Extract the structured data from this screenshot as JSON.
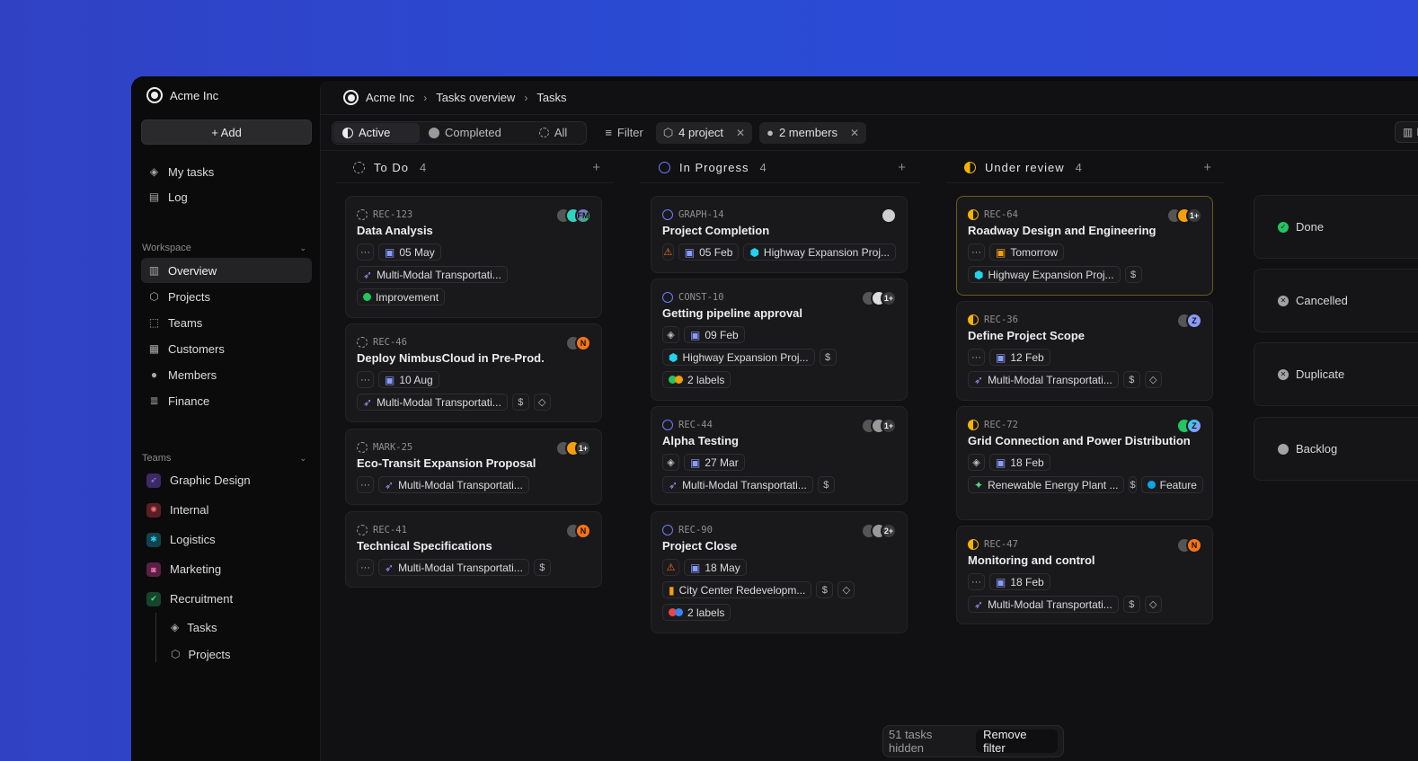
{
  "workspace": {
    "name": "Acme Inc",
    "add_label": "+ Add"
  },
  "nav": {
    "top": [
      {
        "label": "My tasks",
        "icon": "layers-icon"
      },
      {
        "label": "Log",
        "icon": "document-icon"
      }
    ],
    "workspace_heading": "Workspace",
    "workspace_items": [
      {
        "label": "Overview",
        "icon": "bar-chart-icon",
        "active": true
      },
      {
        "label": "Projects",
        "icon": "cube-icon"
      },
      {
        "label": "Teams",
        "icon": "dashed-box-icon"
      },
      {
        "label": "Customers",
        "icon": "building-icon"
      },
      {
        "label": "Members",
        "icon": "users-icon"
      },
      {
        "label": "Finance",
        "icon": "database-icon"
      }
    ],
    "teams_heading": "Teams",
    "teams": [
      {
        "label": "Graphic Design",
        "color": "#8b5cf6"
      },
      {
        "label": "Internal",
        "color": "#ef4444"
      },
      {
        "label": "Logistics",
        "color": "#22b8cf"
      },
      {
        "label": "Marketing",
        "color": "#ec4899"
      },
      {
        "label": "Recruitment",
        "color": "#22c55e"
      }
    ],
    "recruitment_sub": [
      {
        "label": "Tasks",
        "icon": "layers-icon"
      },
      {
        "label": "Projects",
        "icon": "cube-icon"
      }
    ]
  },
  "breadcrumb": {
    "root": "Acme Inc",
    "level1": "Tasks overview",
    "level2": "Tasks"
  },
  "toolbar": {
    "tabs": {
      "active": "Active",
      "completed": "Completed",
      "all": "All"
    },
    "filter_label": "Filter",
    "chip_project": "4 project",
    "chip_members": "2 members",
    "right_btn": "B"
  },
  "columns": {
    "todo": {
      "title": "To Do",
      "count": "4"
    },
    "progress": {
      "title": "In Progress",
      "count": "4"
    },
    "review": {
      "title": "Under review",
      "count": "4"
    }
  },
  "cards": {
    "c1": {
      "id": "REC-123",
      "title": "Data Analysis",
      "date": "05 May",
      "project": "Multi-Modal Transportati...",
      "label": "Improvement",
      "av_text": "FM"
    },
    "c2": {
      "id": "REC-46",
      "title": "Deploy NimbusCloud in Pre-Prod.",
      "date": "10 Aug",
      "project": "Multi-Modal Transportati...",
      "av_text": "N"
    },
    "c3": {
      "id": "MARK-25",
      "title": "Eco-Transit Expansion Proposal",
      "project": "Multi-Modal Transportati...",
      "av_text": "1+"
    },
    "c4": {
      "id": "REC-41",
      "title": "Technical Specifications",
      "project": "Multi-Modal Transportati...",
      "av_text": "N"
    },
    "p1": {
      "id": "GRAPH-14",
      "title": "Project Completion",
      "date": "05 Feb",
      "project": "Highway Expansion Proj..."
    },
    "p2": {
      "id": "CONST-10",
      "title": "Getting pipeline approval",
      "date": "09 Feb",
      "project": "Highway Expansion Proj...",
      "labels": "2 labels",
      "av_text": "1+"
    },
    "p3": {
      "id": "REC-44",
      "title": "Alpha Testing",
      "date": "27 Mar",
      "project": "Multi-Modal Transportati...",
      "av_text": "1+"
    },
    "p4": {
      "id": "REC-90",
      "title": "Project Close",
      "date": "18 May",
      "project": "City Center Redevelopm...",
      "labels": "2 labels",
      "av_text": "2+"
    },
    "r1": {
      "id": "REC-64",
      "title": "Roadway Design and Engineering",
      "date": "Tomorrow",
      "project": "Highway Expansion Proj...",
      "av_text": "1+"
    },
    "r2": {
      "id": "REC-36",
      "title": "Define Project Scope",
      "date": "12 Feb",
      "project": "Multi-Modal Transportati...",
      "av_text": "Z"
    },
    "r3": {
      "id": "REC-72",
      "title": "Grid Connection and Power Distribution",
      "date": "18 Feb",
      "project": "Renewable Energy Plant ...",
      "label": "Feature",
      "av_text": "Z"
    },
    "r4": {
      "id": "REC-47",
      "title": "Monitoring and control",
      "date": "18 Feb",
      "project": "Multi-Modal Transportati...",
      "av_text": "N"
    }
  },
  "statuses": [
    {
      "label": "Done",
      "color": "#22c55e"
    },
    {
      "label": "Cancelled",
      "color": "#a3a3a3"
    },
    {
      "label": "Duplicate",
      "color": "#a3a3a3"
    },
    {
      "label": "Backlog",
      "color": "#a3a3a3"
    }
  ],
  "footer": {
    "hidden_text": "51 tasks hidden",
    "remove_label": "Remove filter"
  },
  "icons": {
    "dollar": "$",
    "more": "···"
  }
}
